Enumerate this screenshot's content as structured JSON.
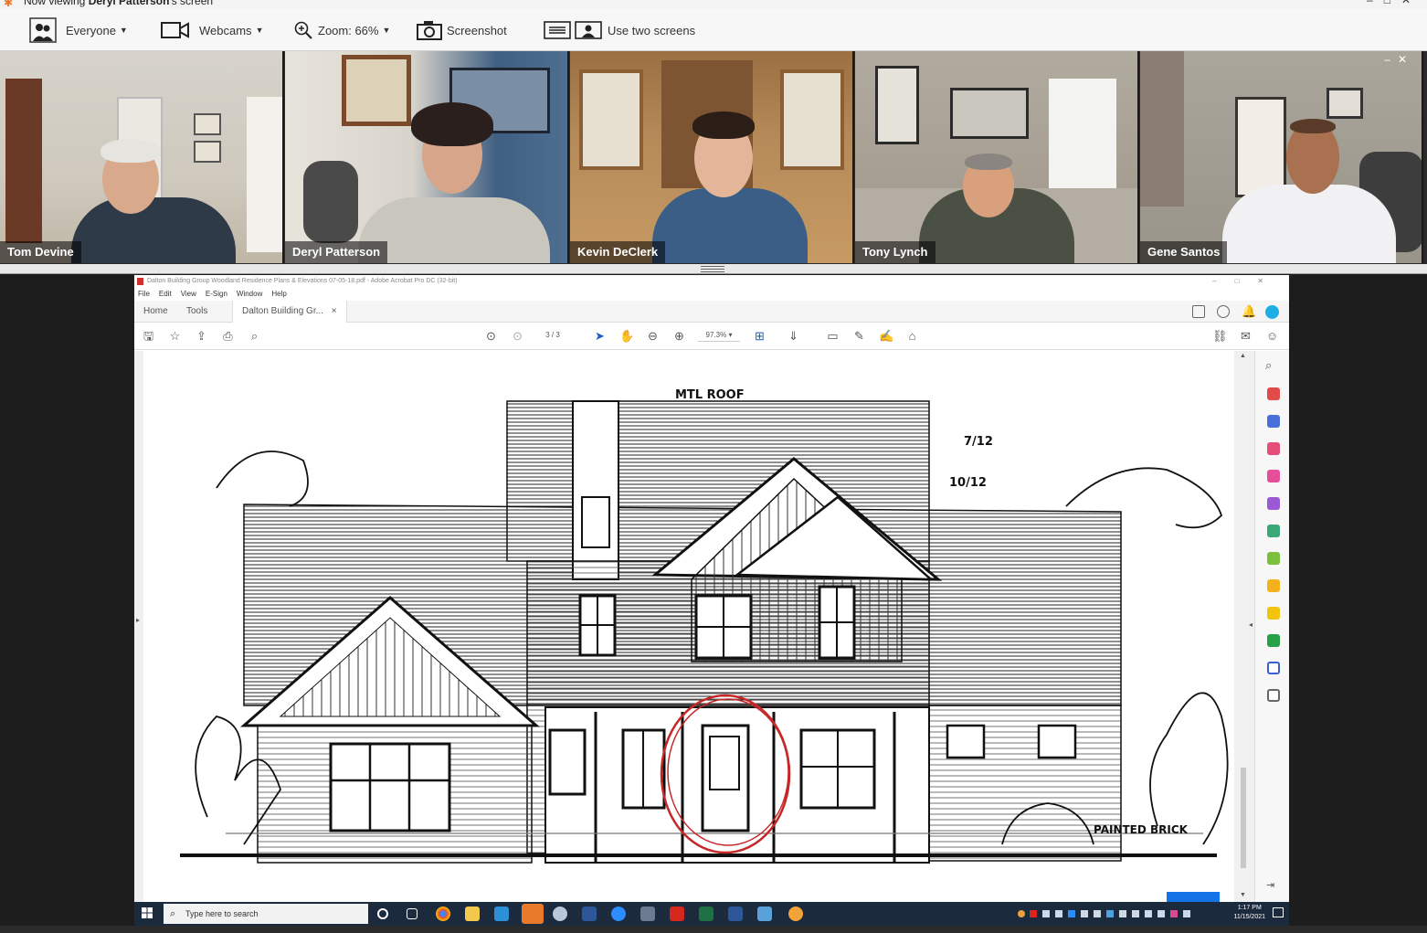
{
  "window": {
    "title_prefix": "Now viewing",
    "title_name": "Deryl Patterson",
    "title_suffix": "'s screen"
  },
  "toolbar": {
    "audience_label": "Everyone",
    "webcams_label": "Webcams",
    "zoom_label": "Zoom: 66%",
    "screenshot_label": "Screenshot",
    "two_screens_label": "Use two screens"
  },
  "webcams": [
    {
      "name": "Tom Devine"
    },
    {
      "name": "Deryl Patterson"
    },
    {
      "name": "Kevin DeClerk"
    },
    {
      "name": "Tony Lynch"
    },
    {
      "name": "Gene Santos"
    }
  ],
  "acrobat": {
    "title": "Dalton Building Group Woodland Residence Plans & Elevations 07-05-18.pdf - Adobe Acrobat Pro DC (32-bit)",
    "menu": [
      "File",
      "Edit",
      "View",
      "E-Sign",
      "Window",
      "Help"
    ],
    "tabs": {
      "home": "Home",
      "tools": "Tools",
      "document": "Dalton Building Gr...",
      "close": "×"
    },
    "page_current": "3",
    "page_total": "/ 3",
    "zoom": "97.3%"
  },
  "drawing": {
    "note_roof": "MTL ROOF",
    "note_pitch_1": "7/12",
    "note_pitch_2": "10/12",
    "note_brick": "PAINTED BRICK"
  },
  "taskbar": {
    "search_placeholder": "Type here to search",
    "time": "1:17 PM",
    "date": "11/15/2021"
  },
  "colors": {
    "taskbar": "#1c2a3e",
    "markup_circle": "#c62828",
    "acrobat_accent": "#1473e6"
  }
}
